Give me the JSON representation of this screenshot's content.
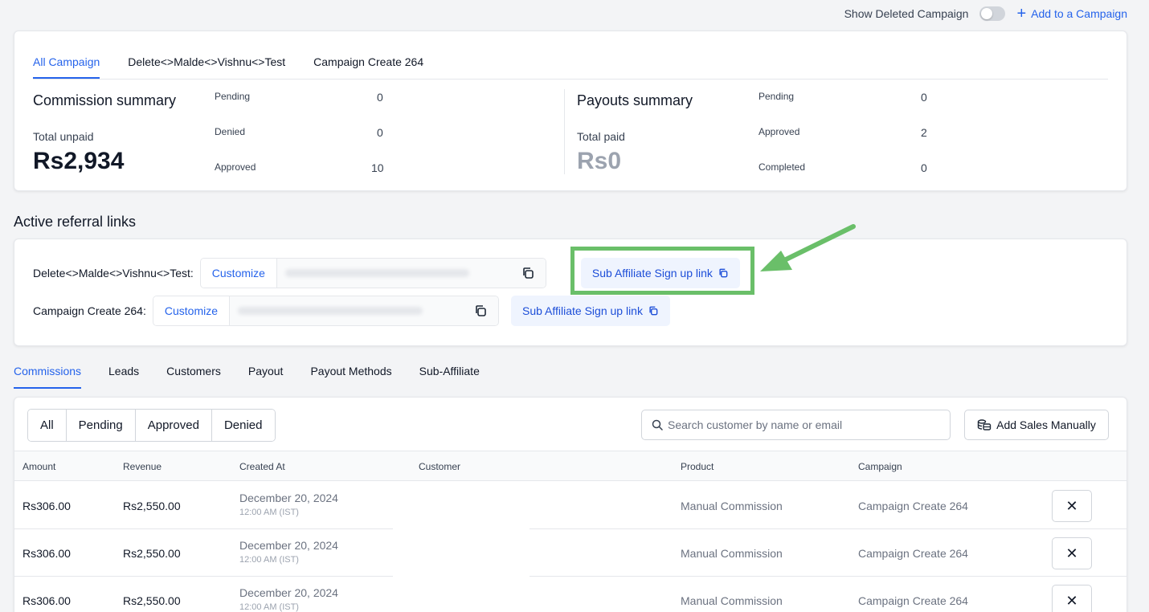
{
  "topbar": {
    "show_deleted_label": "Show Deleted Campaign",
    "add_campaign_label": "Add to a Campaign"
  },
  "campaign_tabs": [
    "All Campaign",
    "Delete<>Malde<>Vishnu<>Test",
    "Campaign Create 264"
  ],
  "commission_summary": {
    "title": "Commission summary",
    "total_label": "Total unpaid",
    "total_value": "Rs2,934",
    "stats": [
      {
        "label": "Pending",
        "value": "0"
      },
      {
        "label": "Denied",
        "value": "0"
      },
      {
        "label": "Approved",
        "value": "10"
      }
    ]
  },
  "payouts_summary": {
    "title": "Payouts summary",
    "total_label": "Total paid",
    "total_value": "Rs0",
    "stats": [
      {
        "label": "Pending",
        "value": "0"
      },
      {
        "label": "Approved",
        "value": "2"
      },
      {
        "label": "Completed",
        "value": "0"
      }
    ]
  },
  "referral": {
    "title": "Active referral links",
    "rows": [
      {
        "label": "Delete<>Malde<>Vishnu<>Test:",
        "customize": "Customize",
        "sub_link": "Sub Affiliate Sign up link"
      },
      {
        "label": "Campaign Create 264:",
        "customize": "Customize",
        "sub_link": "Sub Affiliate Sign up link"
      }
    ]
  },
  "main_tabs": [
    "Commissions",
    "Leads",
    "Customers",
    "Payout",
    "Payout Methods",
    "Sub-Affiliate"
  ],
  "filters": [
    "All",
    "Pending",
    "Approved",
    "Denied"
  ],
  "search": {
    "placeholder": "Search customer by name or email"
  },
  "add_sales_label": "Add Sales Manually",
  "table": {
    "headers": [
      "Amount",
      "Revenue",
      "Created At",
      "Customer",
      "Product",
      "Campaign"
    ],
    "rows": [
      {
        "amount": "Rs306.00",
        "revenue": "Rs2,550.00",
        "date": "December 20, 2024",
        "time": "12:00 AM (IST)",
        "product": "Manual Commission",
        "campaign": "Campaign Create 264"
      },
      {
        "amount": "Rs306.00",
        "revenue": "Rs2,550.00",
        "date": "December 20, 2024",
        "time": "12:00 AM (IST)",
        "product": "Manual Commission",
        "campaign": "Campaign Create 264"
      },
      {
        "amount": "Rs306.00",
        "revenue": "Rs2,550.00",
        "date": "December 20, 2024",
        "time": "12:00 AM (IST)",
        "product": "Manual Commission",
        "campaign": "Campaign Create 264"
      }
    ]
  },
  "colors": {
    "accent": "#2563eb",
    "highlight": "#6abf69"
  }
}
